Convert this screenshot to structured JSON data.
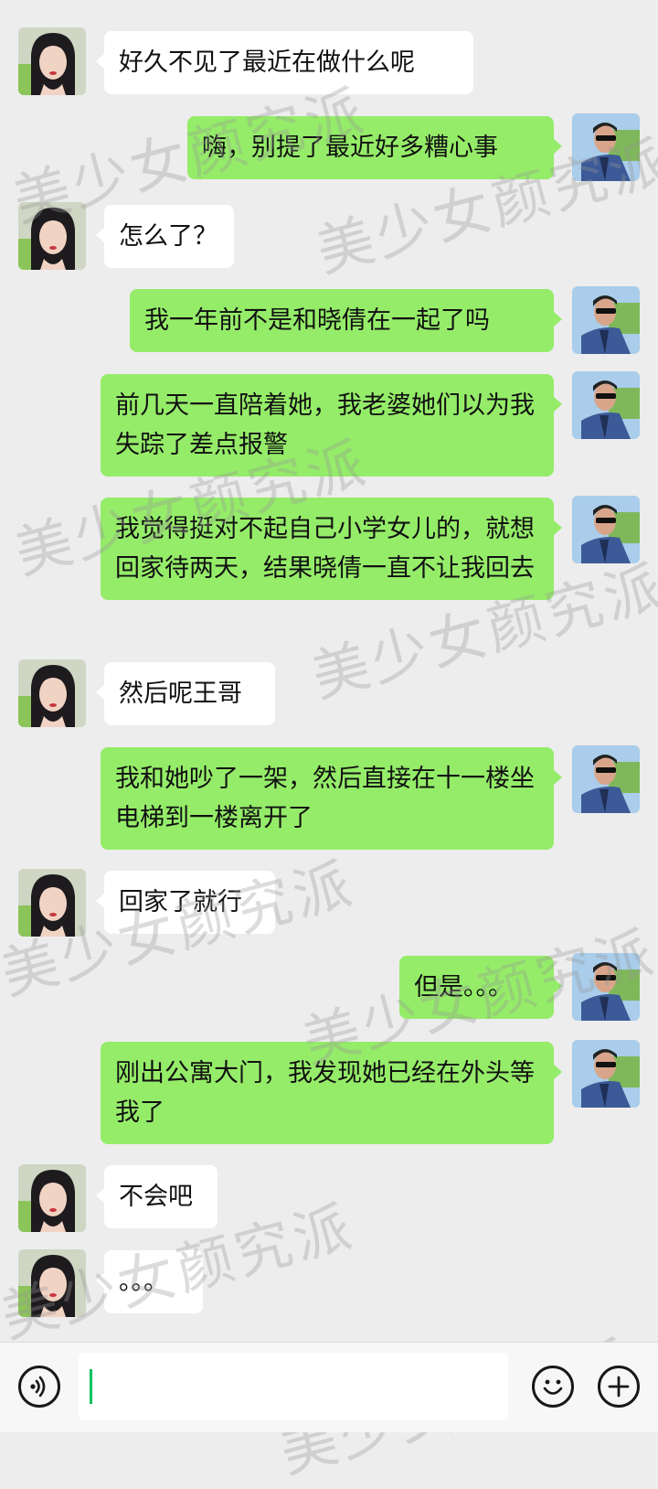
{
  "watermark_text": "美少女颜究派",
  "colors": {
    "background": "#ededed",
    "bubble_in": "#ffffff",
    "bubble_out": "#95ec69",
    "caret": "#07c160"
  },
  "messages": [
    {
      "side": "in",
      "text": "好久不见了最近在做什么呢"
    },
    {
      "side": "out",
      "text": "嗨，别提了最近好多糟心事"
    },
    {
      "side": "in",
      "text": "怎么了？"
    },
    {
      "side": "out",
      "text": "我一年前不是和晓倩在一起了吗"
    },
    {
      "side": "out",
      "text": "前几天一直陪着她，我老婆她们以为我失踪了差点报警"
    },
    {
      "side": "out",
      "text": "我觉得挺对不起自己小学女儿的，就想回家待两天，结果晓倩一直不让我回去"
    },
    {
      "side": "in",
      "text": "然后呢王哥"
    },
    {
      "side": "out",
      "text": "我和她吵了一架，然后直接在十一楼坐电梯到一楼离开了"
    },
    {
      "side": "in",
      "text": "回家了就行"
    },
    {
      "side": "out",
      "text": "但是。。。"
    },
    {
      "side": "out",
      "text": "刚出公寓大门，我发现她已经在外头等我了"
    },
    {
      "side": "in",
      "text": "不会吧"
    },
    {
      "side": "in",
      "text": "。。。"
    }
  ],
  "input_bar": {
    "voice_icon": "voice-icon",
    "emoji_icon": "emoji-icon",
    "plus_icon": "plus-icon",
    "input_value": ""
  }
}
